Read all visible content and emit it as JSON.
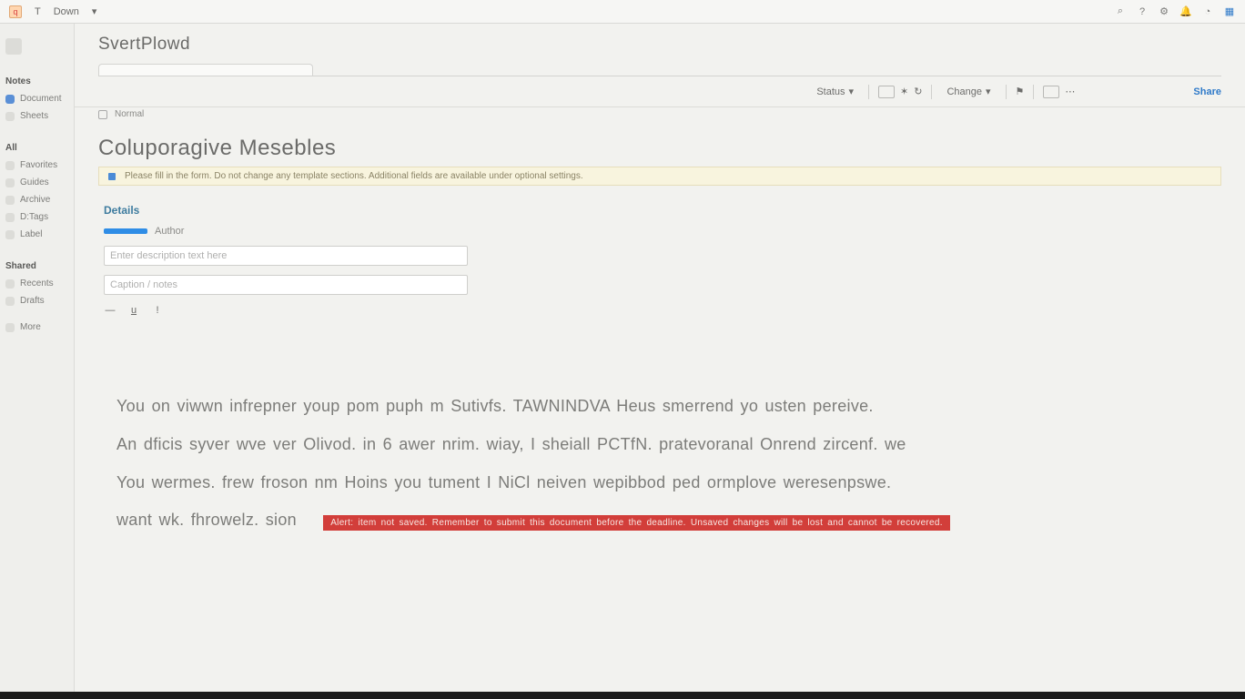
{
  "menubar": {
    "app_glyph": "q",
    "items": [
      "T",
      "Down"
    ],
    "sys_icons": [
      "search-icon",
      "help-icon",
      "settings-icon",
      "bell-icon",
      "avatar-icon",
      "grid-icon"
    ]
  },
  "sidebar": {
    "top_label": "",
    "sections": [
      {
        "label": "Notes",
        "items": [
          "Document",
          "Sheets"
        ]
      },
      {
        "label": "All",
        "items": [
          "Favorites",
          "Guides",
          "Archive",
          "D:Tags",
          "Label"
        ]
      },
      {
        "label": "Shared",
        "items": [
          "Recents",
          "Drafts"
        ]
      },
      {
        "label": "",
        "items": [
          "More"
        ]
      }
    ]
  },
  "header": {
    "doc_title": "SvertPlowd",
    "tab_label": "",
    "status_label": "Status",
    "status_sub": "Normal",
    "toolbar_groups": {
      "left_label": "Change",
      "right_date": "",
      "share_link": "Share"
    }
  },
  "page": {
    "title": "Coluporagive Mesebles",
    "info_strip": "Please fill in the form. Do not change any template sections. Additional fields are available under optional settings.",
    "section_heading": "Details",
    "form": {
      "tag": "",
      "author_field": "Author",
      "description_placeholder": "Enter description text here",
      "caption_placeholder": "Caption / notes"
    },
    "mini_toolbar": [
      "—",
      "u",
      "!"
    ],
    "body_lines": [
      "You on viwwn infrepner youp pom puph m Sutivfs. TAWNINDVA Heus smerrend yo usten pereive.",
      "An dficis syver wve ver Olivod. in 6 awer nrim. wiay, I sheiall PCTfN. pratevoranal Onrend zircenf. we",
      "You wermes. frew froson nm Hoins you tument I NiCl neiven wepibbod ped ormplove weresenpswe.",
      "want wk. fhrowelz. sion"
    ],
    "alert_text": "Alert: item not saved. Remember to submit this document before the deadline. Unsaved changes will be lost and cannot be recovered."
  }
}
